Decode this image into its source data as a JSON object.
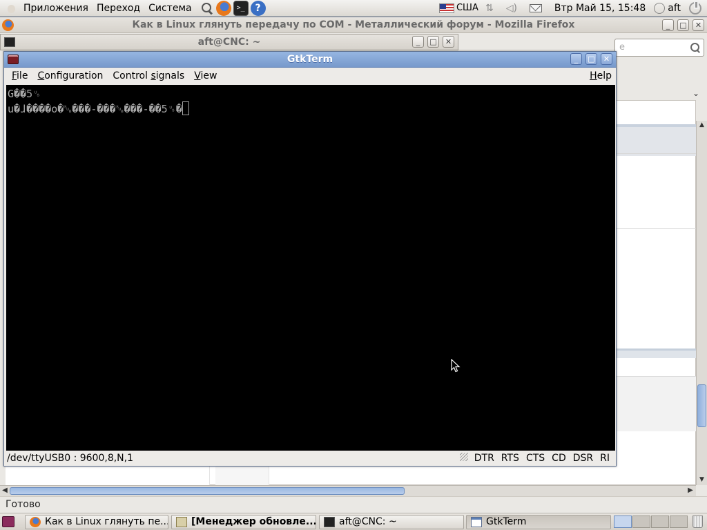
{
  "top_panel": {
    "menus": [
      "Приложения",
      "Переход",
      "Система"
    ],
    "keyboard_layout": "США",
    "clock": "Втр Май 15, 15:48",
    "user": "aft"
  },
  "firefox": {
    "title": "Как в Linux глянуть передачу по COM - Металлический форум - Mozilla Firefox",
    "search_placeholder": "e",
    "status": "Готово"
  },
  "terminal": {
    "title": "aft@CNC: ~"
  },
  "gtkterm": {
    "title": "GtkTerm",
    "menu": {
      "file": "F",
      "file_rest": "ile",
      "configuration": "C",
      "configuration_rest": "onfiguration",
      "control_pre": "Control ",
      "control_u": "s",
      "control_rest": "ignals",
      "view": "V",
      "view_rest": "iew",
      "help": "H",
      "help_rest": "elp"
    },
    "screen_lines": [
      "G��5␟",
      "u�ɺ����o�␚���-���␚���-��5␟�"
    ],
    "port_status": "/dev/ttyUSB0 : 9600,8,N,1",
    "signals": [
      "DTR",
      "RTS",
      "CTS",
      "CD",
      "DSR",
      "RI"
    ]
  },
  "taskbar": {
    "tasks": [
      {
        "label": "Как в Linux глянуть пе...",
        "icon": "firefox-icon"
      },
      {
        "label": "[Менеджер обновле...",
        "icon": "update-manager-icon"
      },
      {
        "label": "aft@CNC: ~",
        "icon": "terminal-icon"
      },
      {
        "label": "GtkTerm",
        "icon": "gtkterm-icon"
      }
    ]
  }
}
